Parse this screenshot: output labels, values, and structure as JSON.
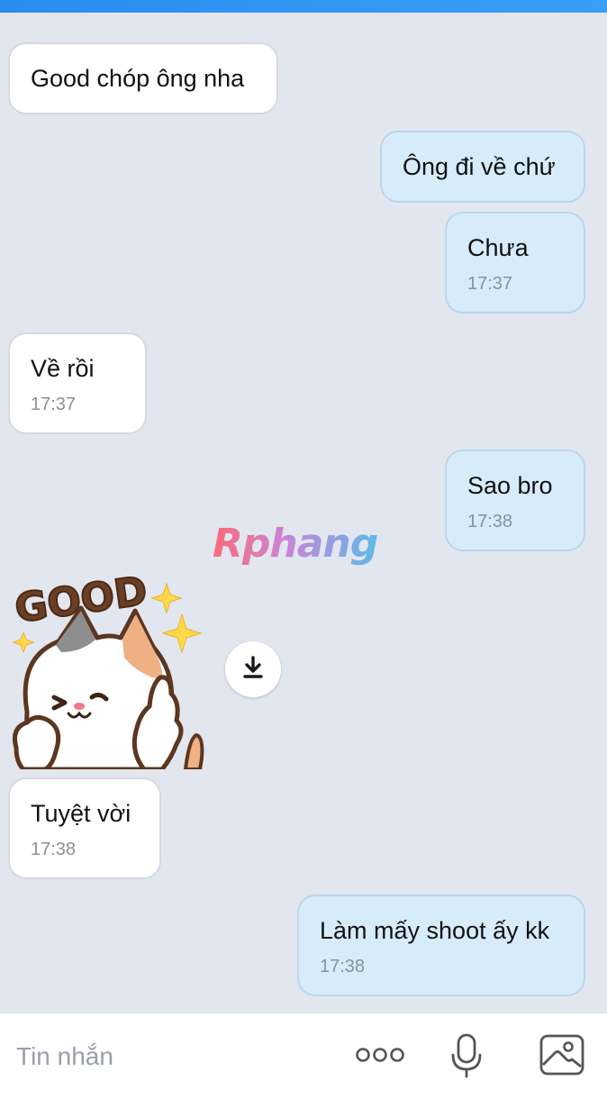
{
  "messages": [
    {
      "direction": "in",
      "text": "Good chóp ông nha",
      "time": ""
    },
    {
      "direction": "out",
      "text": "Ông đi về chứ",
      "time": ""
    },
    {
      "direction": "out",
      "text": "Chưa",
      "time": "17:37"
    },
    {
      "direction": "in",
      "text": "Về rồi",
      "time": "17:37"
    },
    {
      "direction": "out",
      "text": "Sao bro",
      "time": "17:38"
    },
    {
      "direction": "in",
      "text": "Tuyệt vời",
      "time": "17:38"
    },
    {
      "direction": "out",
      "text": "Làm mấy shoot ấy kk",
      "time": "17:38"
    }
  ],
  "watermark": "Rphang",
  "sticker": {
    "caption": "GOOD",
    "icon": "cat-thumbs-up-sticker"
  },
  "download_icon": "download-icon",
  "composer": {
    "placeholder": "Tin nhắn",
    "more_icon": "more-dots-icon",
    "mic_icon": "microphone-icon",
    "image_icon": "image-icon"
  },
  "colors": {
    "background": "#e2e6ee",
    "incoming_bubble": "#ffffff",
    "outgoing_bubble": "#d6ecfb",
    "header": "#2a8cf0",
    "time_text": "#8a9099"
  }
}
